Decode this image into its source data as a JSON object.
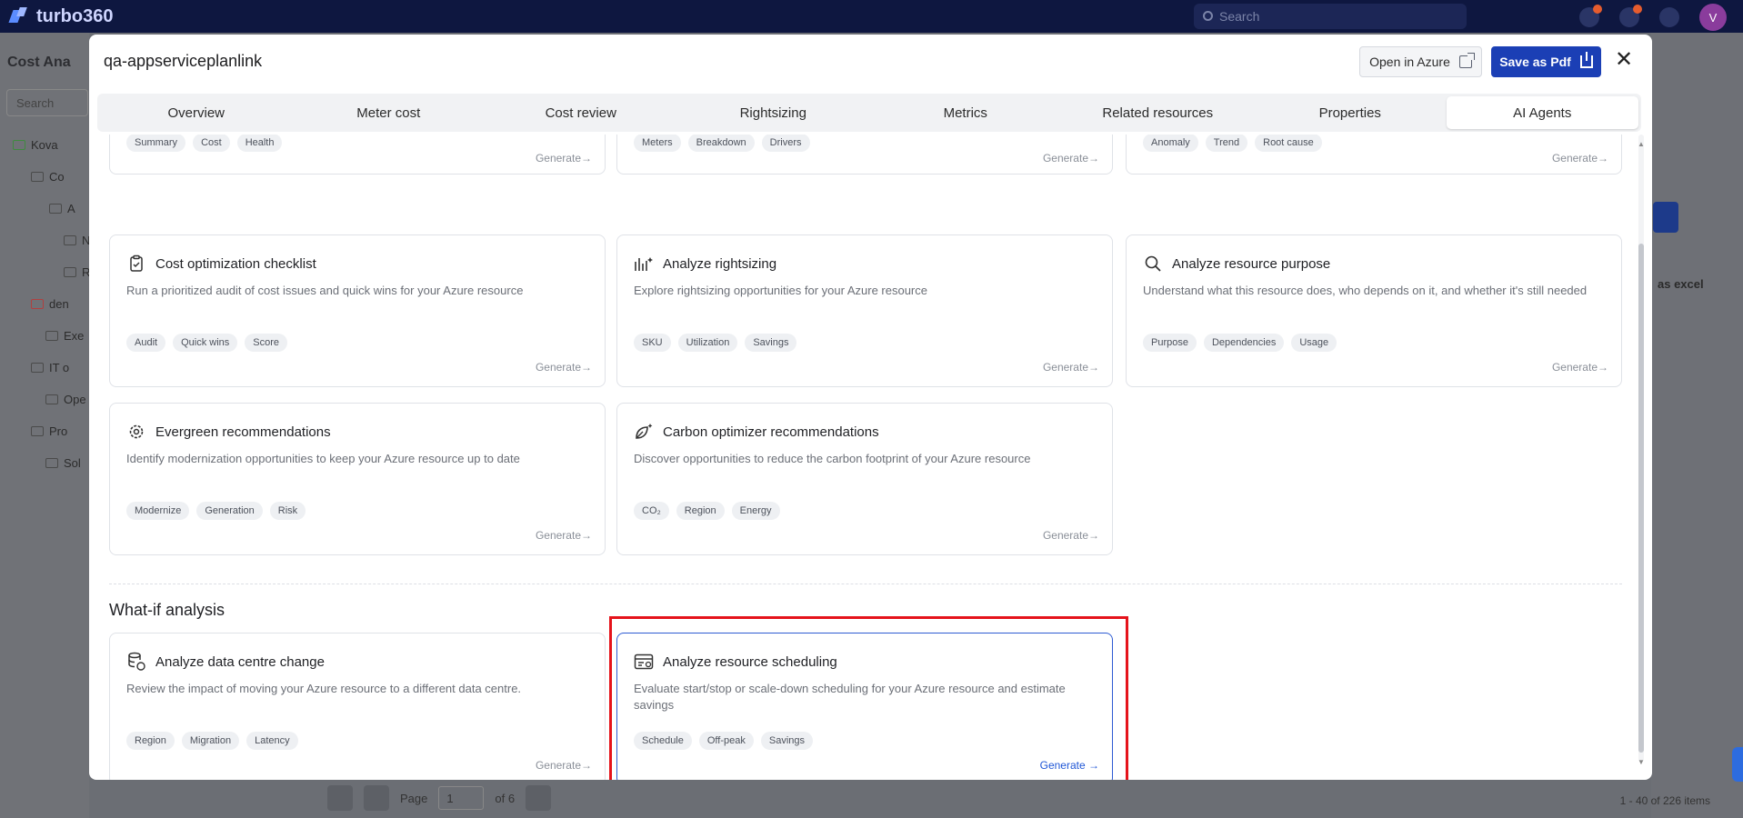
{
  "app": {
    "brand": "turbo360",
    "search_placeholder": "Search",
    "avatar_initial": "V",
    "page_title": "Cost Ana",
    "side_search": "Search",
    "tree_items": [
      "Kova",
      "Co",
      "A",
      "N",
      "R",
      "den",
      "Exe",
      "IT o",
      "Ope",
      "Pro",
      "Sol"
    ],
    "right_label": "as excel",
    "pager": {
      "page_label": "Page",
      "page_value": "1",
      "of_label": "of 6"
    },
    "items_label": "1 - 40 of 226 items"
  },
  "modal": {
    "title": "qa-appserviceplanlink",
    "open_azure_label": "Open in Azure",
    "save_pdf_label": "Save as Pdf",
    "close_label": "✕"
  },
  "tabs": [
    {
      "label": "Overview"
    },
    {
      "label": "Meter cost"
    },
    {
      "label": "Cost review"
    },
    {
      "label": "Rightsizing"
    },
    {
      "label": "Metrics"
    },
    {
      "label": "Related resources"
    },
    {
      "label": "Properties"
    },
    {
      "label": "AI Agents"
    }
  ],
  "active_tab": "AI Agents",
  "partial_cards": [
    {
      "tags": [
        "Summary",
        "Cost",
        "Health"
      ],
      "generate": "Generate→"
    },
    {
      "tags": [
        "Meters",
        "Breakdown",
        "Drivers"
      ],
      "generate": "Generate→"
    },
    {
      "tags": [
        "Anomaly",
        "Trend",
        "Root cause"
      ],
      "generate": "Generate→"
    }
  ],
  "cards": [
    {
      "title": "Cost optimization checklist",
      "desc": "Run a prioritized audit of cost issues and quick wins for your Azure resource",
      "tags": [
        "Audit",
        "Quick wins",
        "Score"
      ],
      "generate": "Generate→",
      "icon": "clipboard-check-icon"
    },
    {
      "title": "Analyze rightsizing",
      "desc": "Explore rightsizing opportunities for your Azure resource",
      "tags": [
        "SKU",
        "Utilization",
        "Savings"
      ],
      "generate": "Generate→",
      "icon": "sparkle-chart-icon"
    },
    {
      "title": "Analyze resource purpose",
      "desc": "Understand what this resource does, who depends on it, and whether it's still needed",
      "tags": [
        "Purpose",
        "Dependencies",
        "Usage"
      ],
      "generate": "Generate→",
      "icon": "magnifier-icon"
    },
    {
      "title": "Evergreen recommendations",
      "desc": "Identify modernization opportunities to keep your Azure resource up to date",
      "tags": [
        "Modernize",
        "Generation",
        "Risk"
      ],
      "generate": "Generate→",
      "icon": "gear-spark-icon"
    },
    {
      "title": "Carbon optimizer recommendations",
      "desc": "Discover opportunities to reduce the carbon footprint of your Azure resource",
      "tags": [
        "CO₂",
        "Region",
        "Energy"
      ],
      "generate": "Generate→",
      "icon": "leaf-spark-icon"
    }
  ],
  "whatif": {
    "section_title": "What-if analysis",
    "cards": [
      {
        "title": "Analyze data centre change",
        "desc": "Review the impact of moving your Azure resource to a different data centre.",
        "tags": [
          "Region",
          "Migration",
          "Latency"
        ],
        "generate": "Generate→",
        "icon": "database-swap-icon"
      },
      {
        "title": "Analyze resource scheduling",
        "desc": "Evaluate start/stop or scale-down scheduling for your Azure resource and estimate savings",
        "tags": [
          "Schedule",
          "Off-peak",
          "Savings"
        ],
        "generate": "Generate →",
        "icon": "schedule-window-icon"
      }
    ]
  },
  "colors": {
    "accent": "#1b3fb5",
    "highlight": "#e5131b",
    "selected_border": "#2d5bd3"
  }
}
